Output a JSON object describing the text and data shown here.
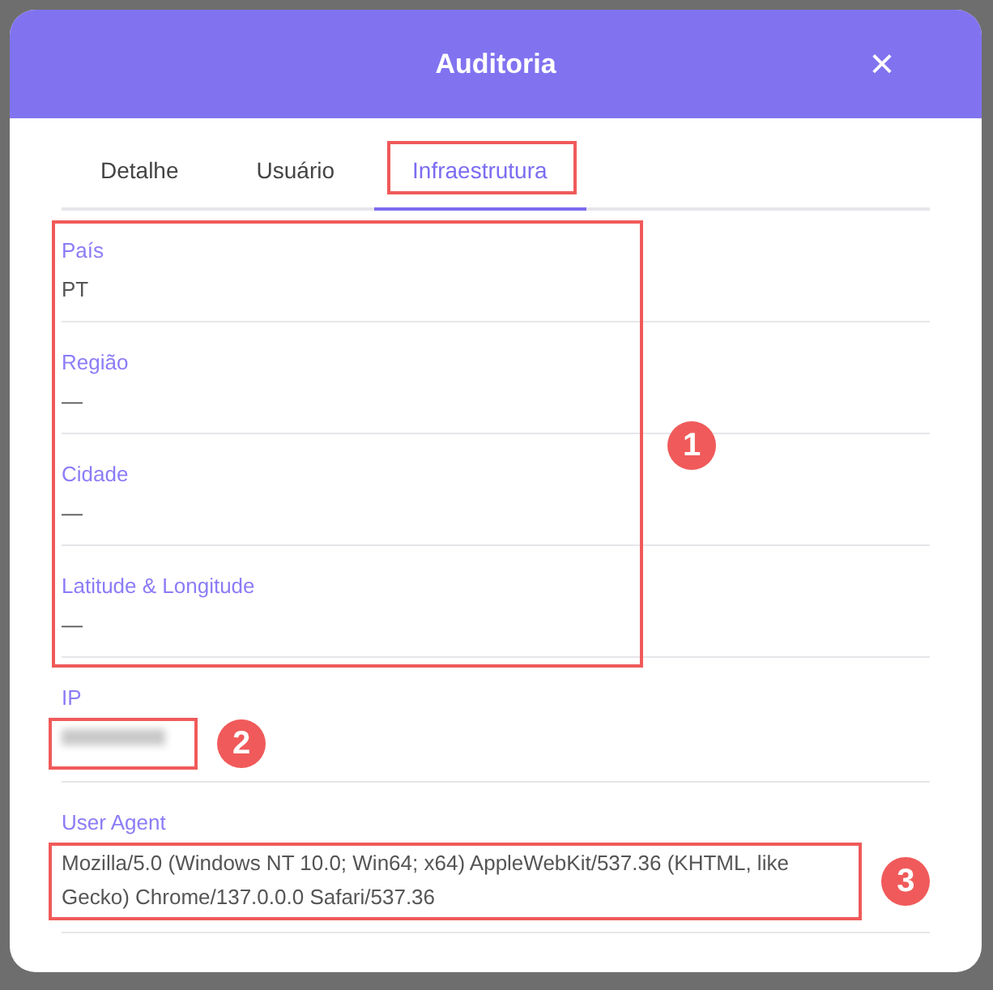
{
  "modal": {
    "title": "Auditoria",
    "close": "×"
  },
  "tabs": [
    {
      "label": "Detalhe",
      "selected": false
    },
    {
      "label": "Usuário",
      "selected": false
    },
    {
      "label": "Infraestrutura",
      "selected": true
    }
  ],
  "fields": [
    {
      "label": "País",
      "value": "PT"
    },
    {
      "label": "Região",
      "value": "—"
    },
    {
      "label": "Cidade",
      "value": "—"
    },
    {
      "label": "Latitude & Longitude",
      "value": "—"
    },
    {
      "label": "IP",
      "redacted": true
    },
    {
      "label": "User Agent",
      "value": "Mozilla/5.0 (Windows NT 10.0; Win64; x64) AppleWebKit/537.36 (KHTML, like Gecko) Chrome/137.0.0.0 Safari/537.36"
    }
  ],
  "annotations": [
    {
      "number": "1",
      "kind": "group"
    },
    {
      "number": "2",
      "kind": "value"
    },
    {
      "number": "3",
      "kind": "value"
    }
  ],
  "tab_annotation": true
}
